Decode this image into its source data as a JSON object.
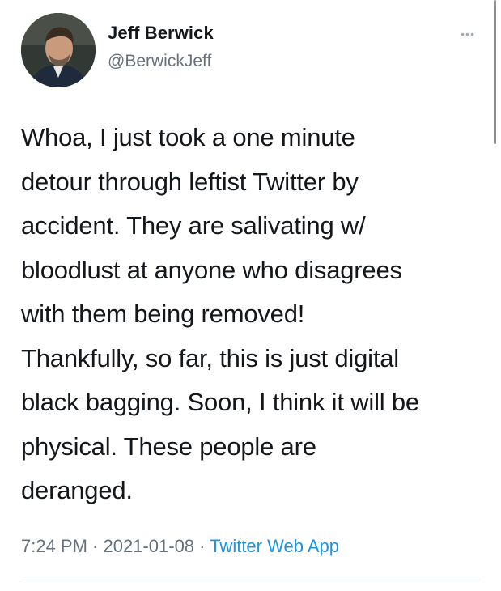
{
  "tweet": {
    "author": {
      "name": "Jeff Berwick",
      "handle": "@BerwickJeff",
      "avatar_icon": "user-avatar"
    },
    "more_icon": "more-options-icon",
    "more_glyph": "•••",
    "text": "Whoa, I just took a one minute\ndetour through leftist Twitter by\naccident.  They are salivating w/\nbloodlust at anyone who disagrees\nwith them being removed!\nThankfully, so far, this is just digital\nblack bagging.  Soon, I think it will be\nphysical.  These people are\nderanged.",
    "meta": {
      "time": "7:24 PM",
      "separator": " · ",
      "date": "2021-01-08",
      "source": "Twitter Web App"
    }
  },
  "colors": {
    "text": "#14171a",
    "secondary": "#65727e",
    "link": "#1b95e0",
    "divider": "#e1e8ed"
  }
}
